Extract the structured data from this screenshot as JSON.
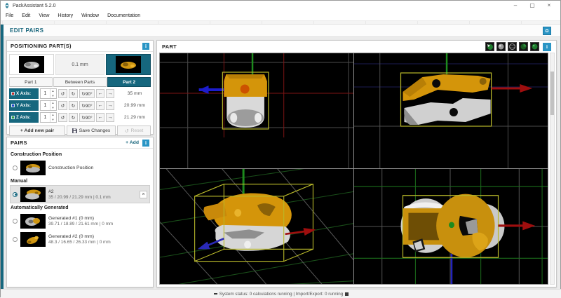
{
  "window": {
    "title": "PackAssistant 5.2.0",
    "minimize": "–",
    "maximize": "▢",
    "close": "×"
  },
  "menu": {
    "items": [
      "File",
      "Edit",
      "View",
      "History",
      "Window",
      "Documentation"
    ]
  },
  "edit_pairs_title": "EDIT PAIRS",
  "positioning": {
    "title": "POSITIONING PART(S)",
    "info": "i",
    "gap": "0.1 mm",
    "tabs": [
      "Part 1",
      "Between Parts",
      "Part 2"
    ],
    "axes": [
      {
        "label": "X Axis:",
        "value": "1",
        "result": "35 mm"
      },
      {
        "label": "Y Axis:",
        "value": "1",
        "result": "20.99 mm"
      },
      {
        "label": "Z Axis:",
        "value": "1",
        "result": "21.29 mm"
      }
    ],
    "controls": {
      "ccw": "↺",
      "cw": "↻",
      "rot90": "↻90°",
      "left": "←",
      "right": "→"
    },
    "spin_up": "▲",
    "spin_down": "▼",
    "add_pair": "+ Add new pair",
    "save": "Save Changes",
    "reset": "Reset"
  },
  "pairs": {
    "title": "PAIRS",
    "add": "+ Add",
    "info": "i",
    "section_construction": "Construction Position",
    "section_manual": "Manual",
    "section_auto": "Automatically Generated",
    "items": [
      {
        "title": "Construction Position",
        "subtitle": ""
      },
      {
        "title": "#2",
        "subtitle": "35 / 20.99 / 21.29 mm | 0.1 mm"
      },
      {
        "title": "Generated #1 (0 mm)",
        "subtitle": "39.71 / 18.89 / 21.61 mm | 0 mm"
      },
      {
        "title": "Generated #2 (0 mm)",
        "subtitle": "48.3 / 16.65 / 26.33 mm | 0 mm"
      }
    ],
    "close": "×"
  },
  "part": {
    "title": "PART",
    "info": "i"
  },
  "status": {
    "text": "System status: 0 calculations running  |  Import/Export: 0 running"
  },
  "colors": {
    "accent": "#16677e",
    "info_blue": "#2a95c5",
    "part_gold": "#d4950a",
    "part_grey": "#d6d6d6",
    "bbox_yellow": "#b9b92a",
    "axis_x_red": "#c62828",
    "axis_y_blue": "#2244cc",
    "axis_z_green": "#2e9e44"
  }
}
